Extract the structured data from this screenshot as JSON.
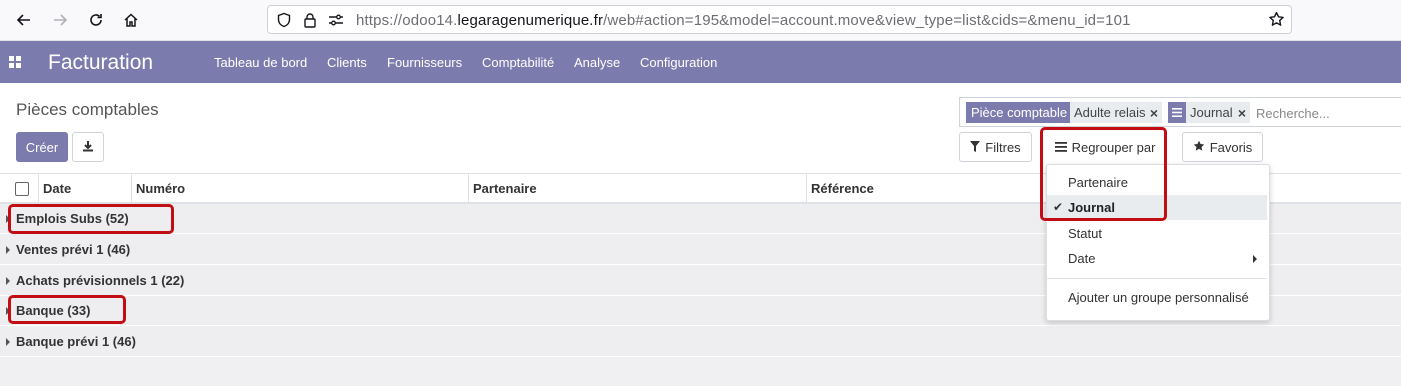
{
  "browser": {
    "url_prefix": "https://odoo14.",
    "url_domain": "legaragenumerique.fr",
    "url_path": "/web#action=195&model=account.move&view_type=list&cids=&menu_id=101",
    "icons": [
      "back-arrow-icon",
      "forward-arrow-icon",
      "reload-icon",
      "home-icon",
      "shield-icon",
      "lock-icon",
      "permissions-icon",
      "bookmark-star-icon"
    ]
  },
  "navbar": {
    "app_name": "Facturation",
    "menu": [
      "Tableau de bord",
      "Clients",
      "Fournisseurs",
      "Comptabilité",
      "Analyse",
      "Configuration"
    ],
    "color": "#7c7bad"
  },
  "control_panel": {
    "breadcrumb": "Pièces comptables",
    "create_label": "Créer",
    "search": {
      "facets": [
        {
          "label": "Pièce comptable",
          "value": "Adulte relais"
        },
        {
          "label": "",
          "value": "Journal"
        }
      ],
      "placeholder": "Recherche..."
    },
    "filters_label": "Filtres",
    "groupby_label": "Regrouper par",
    "favorites_label": "Favoris"
  },
  "list": {
    "columns": [
      "Date",
      "Numéro",
      "Partenaire",
      "Référence"
    ],
    "groups": [
      {
        "label": "Emplois Subs (52)"
      },
      {
        "label": "Ventes prévi 1 (46)"
      },
      {
        "label": "Achats prévisionnels 1 (22)"
      },
      {
        "label": "Banque (33)"
      },
      {
        "label": "Banque prévi 1 (46)"
      }
    ]
  },
  "groupby_dropdown": {
    "items": [
      {
        "label": "Partenaire",
        "selected": false
      },
      {
        "label": "Journal",
        "selected": true
      },
      {
        "label": "Statut",
        "selected": false
      },
      {
        "label": "Date",
        "selected": false,
        "submenu": true
      }
    ],
    "custom_group_label": "Ajouter un groupe personnalisé"
  },
  "annotation_color": "#c10d14"
}
